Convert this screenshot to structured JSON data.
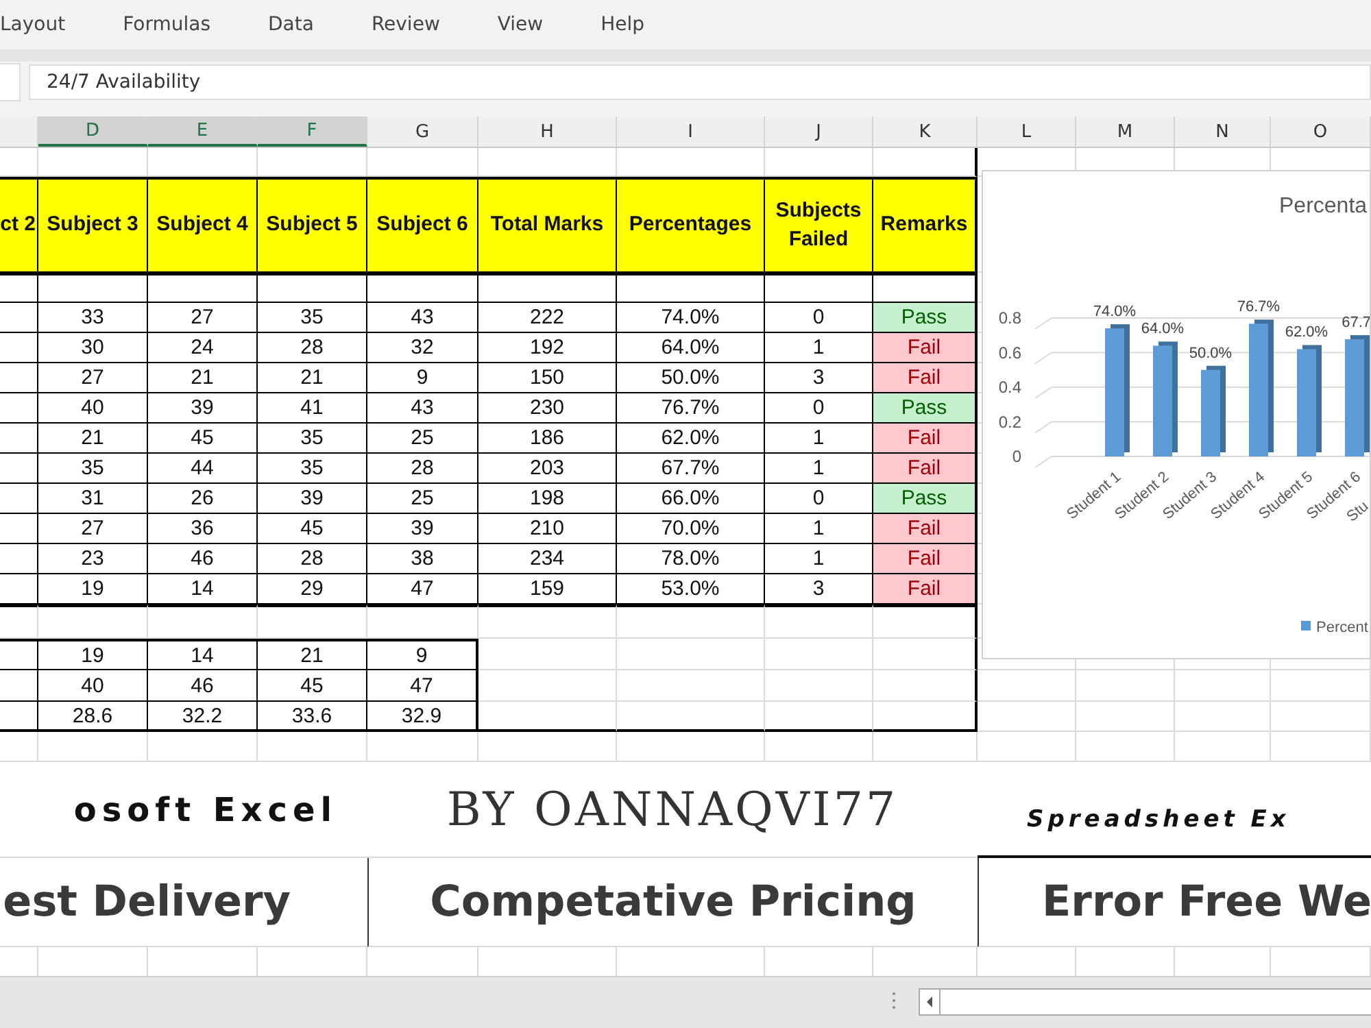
{
  "menu": [
    {
      "label": "Layout"
    },
    {
      "label": "Formulas"
    },
    {
      "label": "Data"
    },
    {
      "label": "Review"
    },
    {
      "label": "View"
    },
    {
      "label": "Help"
    }
  ],
  "formula_bar": {
    "value": "24/7 Availability"
  },
  "column_headers": [
    {
      "label": "D",
      "selected": true
    },
    {
      "label": "E",
      "selected": true
    },
    {
      "label": "F",
      "selected": true
    },
    {
      "label": "G",
      "selected": false
    },
    {
      "label": "H",
      "selected": false
    },
    {
      "label": "I",
      "selected": false
    },
    {
      "label": "J",
      "selected": false
    },
    {
      "label": "K",
      "selected": false
    },
    {
      "label": "L",
      "selected": false
    },
    {
      "label": "M",
      "selected": false
    },
    {
      "label": "N",
      "selected": false
    },
    {
      "label": "O",
      "selected": false
    }
  ],
  "table": {
    "headers": [
      "ct 2",
      "Subject 3",
      "Subject 4",
      "Subject 5",
      "Subject 6",
      "Total Marks",
      "Percentages",
      "Subjects Failed",
      "Remarks"
    ],
    "rows": [
      {
        "cells": [
          "33",
          "27",
          "35",
          "43",
          "222",
          "74.0%",
          "0"
        ],
        "remark": "Pass",
        "kind": "pass"
      },
      {
        "cells": [
          "30",
          "24",
          "28",
          "32",
          "192",
          "64.0%",
          "1"
        ],
        "remark": "Fail",
        "kind": "fail"
      },
      {
        "cells": [
          "27",
          "21",
          "21",
          "9",
          "150",
          "50.0%",
          "3"
        ],
        "remark": "Fail",
        "kind": "fail"
      },
      {
        "cells": [
          "40",
          "39",
          "41",
          "43",
          "230",
          "76.7%",
          "0"
        ],
        "remark": "Pass",
        "kind": "pass"
      },
      {
        "cells": [
          "21",
          "45",
          "35",
          "25",
          "186",
          "62.0%",
          "1"
        ],
        "remark": "Fail",
        "kind": "fail"
      },
      {
        "cells": [
          "35",
          "44",
          "35",
          "28",
          "203",
          "67.7%",
          "1"
        ],
        "remark": "Fail",
        "kind": "fail"
      },
      {
        "cells": [
          "31",
          "26",
          "39",
          "25",
          "198",
          "66.0%",
          "0"
        ],
        "remark": "Pass",
        "kind": "pass"
      },
      {
        "cells": [
          "27",
          "36",
          "45",
          "39",
          "210",
          "70.0%",
          "1"
        ],
        "remark": "Fail",
        "kind": "fail"
      },
      {
        "cells": [
          "23",
          "46",
          "28",
          "38",
          "234",
          "78.0%",
          "1"
        ],
        "remark": "Fail",
        "kind": "fail"
      },
      {
        "cells": [
          "19",
          "14",
          "29",
          "47",
          "159",
          "53.0%",
          "3"
        ],
        "remark": "Fail",
        "kind": "fail"
      }
    ]
  },
  "stats": {
    "rows": [
      [
        "19",
        "14",
        "21",
        "9"
      ],
      [
        "40",
        "46",
        "45",
        "47"
      ],
      [
        "28.6",
        "32.2",
        "33.6",
        "32.9"
      ]
    ]
  },
  "chart": {
    "chart_data": {
      "type": "bar",
      "title": "Percenta",
      "categories": [
        "Student 1",
        "Student 2",
        "Student 3",
        "Student 4",
        "Student 5",
        "Student 6",
        "Stu"
      ],
      "series": [
        {
          "name": "Percent",
          "color": "#5b9bd5",
          "values": [
            0.74,
            0.64,
            0.5,
            0.767,
            0.62,
            0.677,
            null
          ]
        }
      ],
      "ylim": [
        0,
        0.8
      ],
      "yticks": [
        0,
        0.2,
        0.4,
        0.6,
        0.8
      ],
      "grid": true,
      "value_labels": [
        "74.0%",
        "64.0%",
        "50.0%",
        "76.7%",
        "62.0%",
        "67.7"
      ]
    }
  },
  "banners": [
    [
      {
        "text": "osoft Excel",
        "kind": "title"
      },
      {
        "text": "BY OANNAQVI77",
        "kind": "author"
      },
      {
        "text": "Spreadsheet Ex",
        "kind": "tagline"
      }
    ],
    [
      {
        "text": "est Delivery",
        "kind": "feature"
      },
      {
        "text": "Competative Pricing",
        "kind": "feature"
      },
      {
        "text": "Error Free We",
        "kind": "feature"
      }
    ]
  ]
}
